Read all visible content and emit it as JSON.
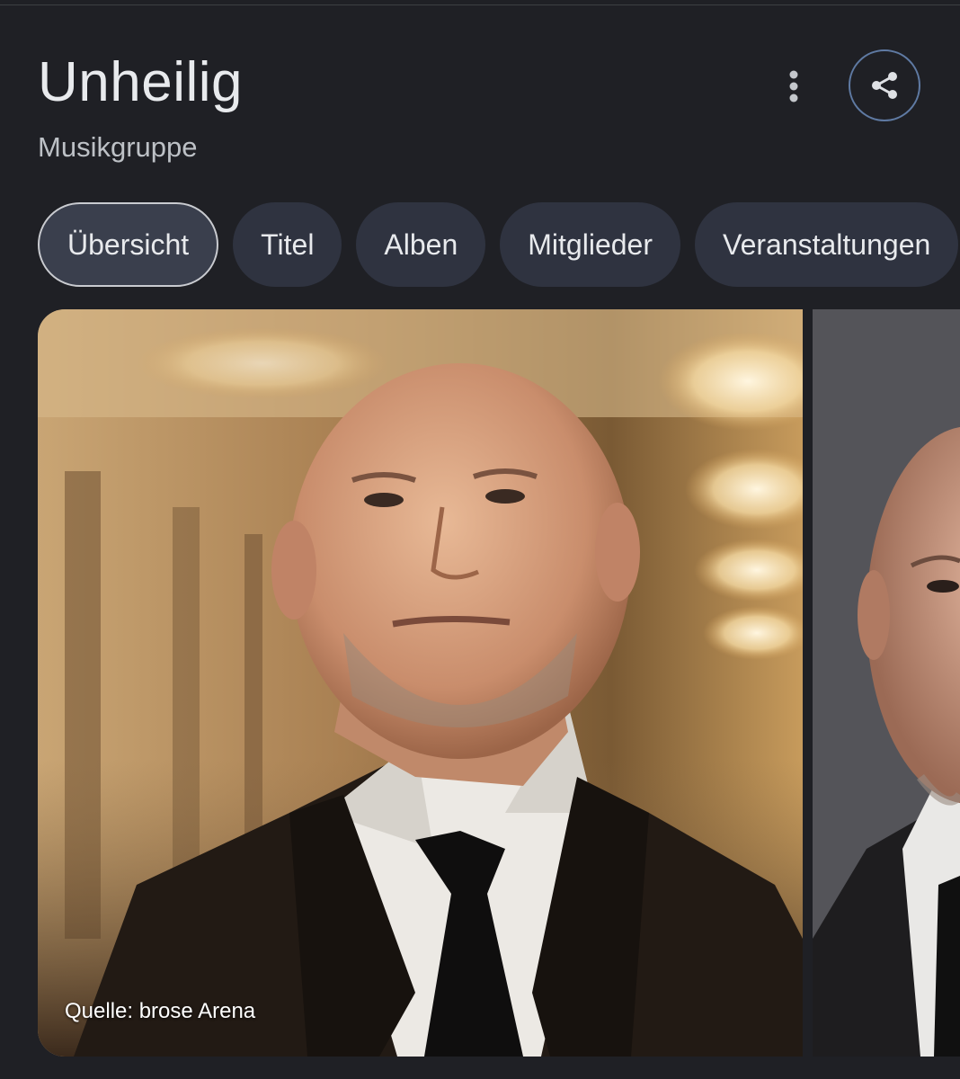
{
  "entity": {
    "title": "Unheilig",
    "subtitle": "Musikgruppe"
  },
  "actions": {
    "more_icon": "more-vert-icon",
    "share_icon": "share-icon"
  },
  "tabs": [
    {
      "label": "Übersicht",
      "active": true
    },
    {
      "label": "Titel",
      "active": false
    },
    {
      "label": "Alben",
      "active": false
    },
    {
      "label": "Mitglieder",
      "active": false
    },
    {
      "label": "Veranstaltungen",
      "active": false
    }
  ],
  "images": {
    "main_caption": "Quelle: brose Arena"
  },
  "colors": {
    "background": "#1f2025",
    "tab_background": "#2f3340",
    "share_border": "#5f7aa3"
  }
}
